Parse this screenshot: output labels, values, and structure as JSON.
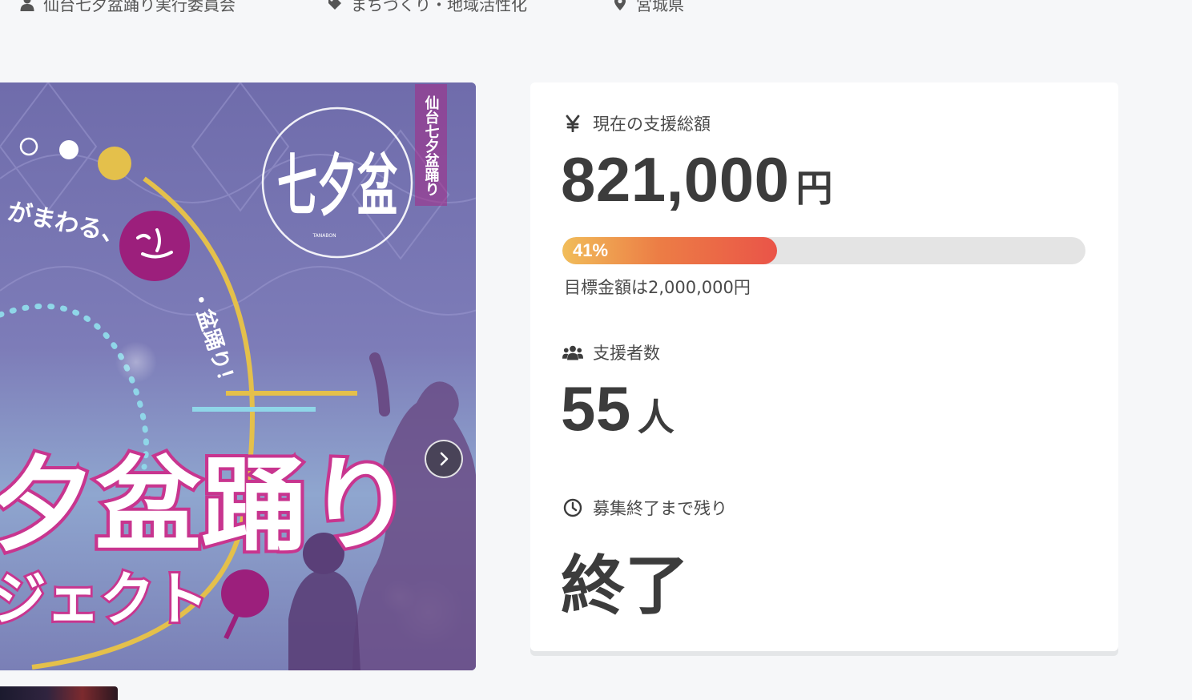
{
  "meta": {
    "organizer": "仙台七夕盆踊り実行委員会",
    "category": "まちづくり・地域活性化",
    "location": "宮城県"
  },
  "hero": {
    "image_text": {
      "vertical_title": "仙台七夕盆踊り",
      "logo_mark": "七夕盆",
      "logo_caption": "TANABON",
      "catch_line": "がまわる、",
      "side_text": "・盆踊り！",
      "main_title": "夕盆踊り",
      "sub_title": "ジェクト"
    }
  },
  "stats": {
    "total": {
      "icon": "yen-icon",
      "label": "現在の支援総額",
      "amount": "821,000",
      "unit": "円"
    },
    "progress": {
      "percent_label": "41%",
      "fraction": 0.41,
      "goal_text": "目標金額は2,000,000円"
    },
    "supporters": {
      "icon": "users-icon",
      "label": "支援者数",
      "count": "55",
      "unit": "人"
    },
    "remaining": {
      "icon": "clock-icon",
      "label": "募集終了まで残り",
      "value": "終了"
    }
  },
  "colors": {
    "page_bg": "#f6f7f9",
    "card_bg": "#ffffff",
    "text": "#3c3c3c",
    "progress_start": "#f1bd5a",
    "progress_end": "#ea5448",
    "progress_track": "#e4e4e4",
    "magenta": "#a42a86"
  }
}
